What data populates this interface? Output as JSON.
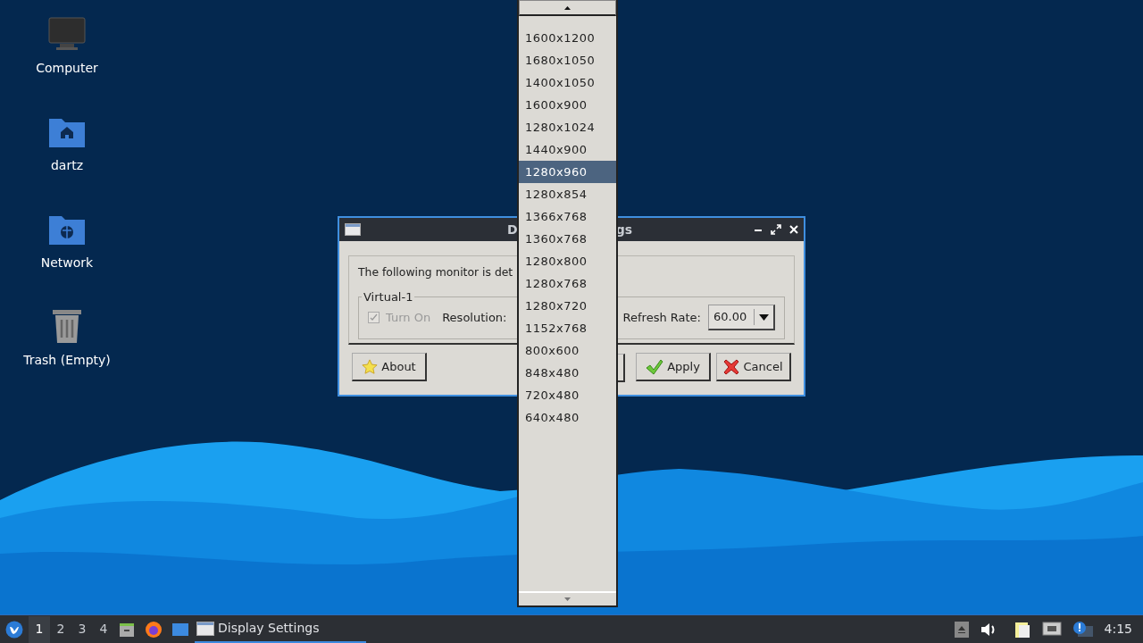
{
  "desktop_icons": [
    {
      "label": "Computer",
      "kind": "computer"
    },
    {
      "label": "dartz",
      "kind": "home"
    },
    {
      "label": "Network",
      "kind": "network"
    },
    {
      "label": "Trash (Empty)",
      "kind": "trash"
    }
  ],
  "dialog": {
    "title_parts": [
      "D",
      "gs"
    ],
    "message": "The following monitor is det",
    "group_label": "Virtual-1",
    "turn_on": {
      "label": "Turn On",
      "checked": true,
      "disabled": true
    },
    "resolution_label": "Resolution:",
    "refresh_label": "Refresh Rate:",
    "refresh_value": "60.00",
    "buttons": [
      {
        "label": "About",
        "kind": "about"
      },
      {
        "label": "Apply",
        "kind": "apply"
      },
      {
        "label": "Cancel",
        "kind": "cancel"
      }
    ]
  },
  "dropdown": {
    "items": [
      {
        "label": "1600x1200",
        "selected": false
      },
      {
        "label": "1680x1050",
        "selected": false
      },
      {
        "label": "1400x1050",
        "selected": false
      },
      {
        "label": "1600x900",
        "selected": false
      },
      {
        "label": "1280x1024",
        "selected": false
      },
      {
        "label": "1440x900",
        "selected": false
      },
      {
        "label": "1280x960",
        "selected": true
      },
      {
        "label": "1280x854",
        "selected": false
      },
      {
        "label": "1366x768",
        "selected": false
      },
      {
        "label": "1360x768",
        "selected": false
      },
      {
        "label": "1280x800",
        "selected": false
      },
      {
        "label": "1280x768",
        "selected": false
      },
      {
        "label": "1280x720",
        "selected": false
      },
      {
        "label": "1152x768",
        "selected": false
      },
      {
        "label": "800x600",
        "selected": false
      },
      {
        "label": "848x480",
        "selected": false
      },
      {
        "label": "720x480",
        "selected": false
      },
      {
        "label": "640x480",
        "selected": false
      }
    ]
  },
  "taskbar": {
    "workspaces": [
      {
        "label": "1",
        "selected": true
      },
      {
        "label": "2",
        "selected": false
      },
      {
        "label": "3",
        "selected": false
      },
      {
        "label": "4",
        "selected": false
      }
    ],
    "task": {
      "label": "Display Settings",
      "selected": true
    },
    "clock": "4:15"
  }
}
